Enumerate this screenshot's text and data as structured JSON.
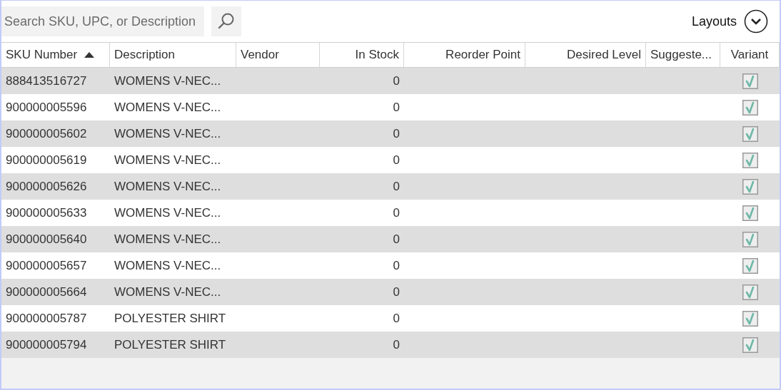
{
  "search": {
    "placeholder": "Search SKU, UPC, or Description"
  },
  "layouts_button": {
    "label": "Layouts"
  },
  "table": {
    "columns": [
      {
        "label": "SKU Number",
        "sorted": true
      },
      {
        "label": "Description",
        "sorted": false
      },
      {
        "label": "Vendor",
        "sorted": false
      },
      {
        "label": "In Stock",
        "sorted": false
      },
      {
        "label": "Reorder Point",
        "sorted": false
      },
      {
        "label": "Desired Level",
        "sorted": false
      },
      {
        "label": "Suggeste...",
        "sorted": false
      },
      {
        "label": "Variant",
        "sorted": false
      }
    ],
    "rows": [
      {
        "sku": "888413516727",
        "description": "WOMENS V-NEC...",
        "in_stock": "0",
        "variant": true
      },
      {
        "sku": "900000005596",
        "description": "WOMENS V-NEC...",
        "in_stock": "0",
        "variant": true
      },
      {
        "sku": "900000005602",
        "description": "WOMENS V-NEC...",
        "in_stock": "0",
        "variant": true
      },
      {
        "sku": "900000005619",
        "description": "WOMENS V-NEC...",
        "in_stock": "0",
        "variant": true
      },
      {
        "sku": "900000005626",
        "description": "WOMENS V-NEC...",
        "in_stock": "0",
        "variant": true
      },
      {
        "sku": "900000005633",
        "description": "WOMENS V-NEC...",
        "in_stock": "0",
        "variant": true
      },
      {
        "sku": "900000005640",
        "description": "WOMENS V-NEC...",
        "in_stock": "0",
        "variant": true
      },
      {
        "sku": "900000005657",
        "description": "WOMENS V-NEC...",
        "in_stock": "0",
        "variant": true
      },
      {
        "sku": "900000005664",
        "description": "WOMENS V-NEC...",
        "in_stock": "0",
        "variant": true
      },
      {
        "sku": "900000005787",
        "description": "POLYESTER SHIRT",
        "in_stock": "0",
        "variant": true
      },
      {
        "sku": "900000005794",
        "description": "POLYESTER SHIRT",
        "in_stock": "0",
        "variant": true
      }
    ]
  }
}
